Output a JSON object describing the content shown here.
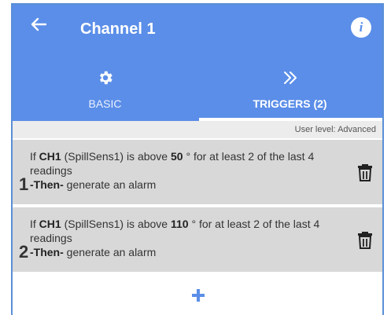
{
  "header": {
    "title": "Channel 1",
    "info_symbol": "i"
  },
  "tabs": [
    {
      "label": "BASIC",
      "icon": "gear-icon"
    },
    {
      "label": "TRIGGERS (2)",
      "icon": "double-chevron-right-icon"
    }
  ],
  "user_level": "User level: Advanced",
  "triggers": [
    {
      "number": "1",
      "prefix": "If",
      "channel": "CH1",
      "sensor": "(SpillSens1) is above",
      "threshold": "50",
      "suffix": "° for at least 2 of the last 4 readings",
      "then_label": "-Then-",
      "action": "generate an alarm"
    },
    {
      "number": "2",
      "prefix": "If",
      "channel": "CH1",
      "sensor": "(SpillSens1) is above",
      "threshold": "110",
      "suffix": "° for at least 2 of the last 4 readings",
      "then_label": "-Then-",
      "action": "generate an alarm"
    }
  ],
  "colors": {
    "accent": "#5b8ee8",
    "row_bg": "#d8d8d8"
  }
}
